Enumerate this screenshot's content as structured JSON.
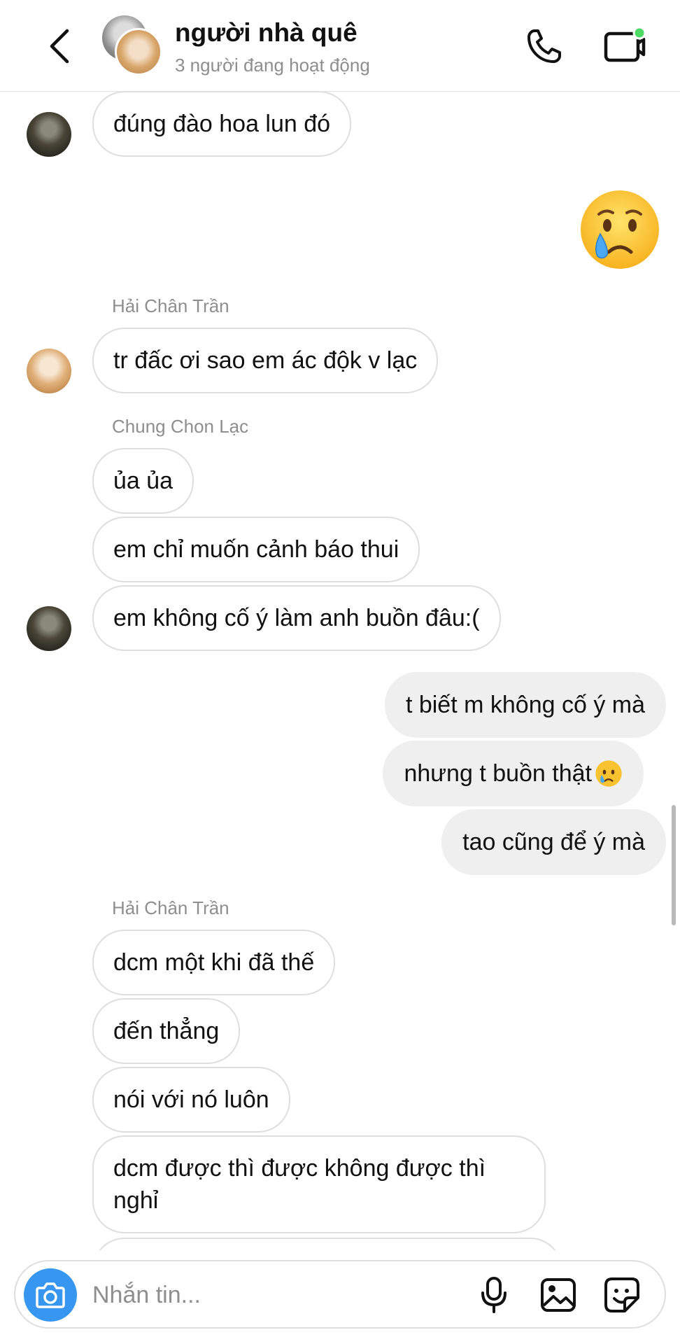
{
  "header": {
    "title": "người nhà quê",
    "subtitle": "3 người đang hoạt động",
    "online_dot_color": "#4cd964"
  },
  "messages": {
    "m1": "đúng đào hoa lun đó",
    "m2_sender": "Hải Chân Trần",
    "m2": "tr đấc ơi sao em ác độk v lạc",
    "m3_sender": "Chung Chon Lạc",
    "m3a": "ủa ủa",
    "m3b": "em chỉ muốn cảnh báo thui",
    "m3c": "em không cố ý làm anh buồn đâu:(",
    "me1": "t biết m không cố ý mà",
    "me2": "nhưng t buồn thật",
    "me3": "tao cũng để ý mà",
    "m4_sender": "Hải Chân Trần",
    "m4a": "dcm một khi đã thế",
    "m4b": "đến thẳng",
    "m4c": "nói với nó luôn",
    "m4d": "dcm được thì được không được thì nghỉ"
  },
  "composer": {
    "placeholder": "Nhắn tin..."
  },
  "icons": {
    "back": "chevron-left-icon",
    "call": "phone-icon",
    "video": "video-icon",
    "camera": "camera-icon",
    "mic": "microphone-icon",
    "gallery": "image-icon",
    "sticker": "sticker-icon",
    "crying_emoji": "crying-face-emoji"
  },
  "colors": {
    "accent": "#3797f0",
    "outgoing_bubble": "#efefef",
    "muted_text": "#8e8e8e"
  }
}
